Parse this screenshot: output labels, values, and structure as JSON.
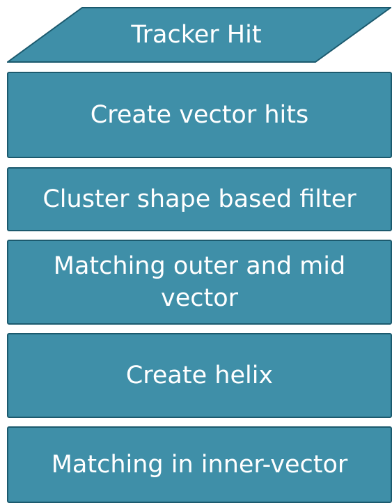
{
  "colors": {
    "box_fill": "#3f8fa8",
    "box_border": "#1c5a6e",
    "text": "#ffffff"
  },
  "input": {
    "label": "Tracker Hit"
  },
  "steps": [
    {
      "label": "Create vector hits"
    },
    {
      "label": "Cluster shape based filter"
    },
    {
      "label": "Matching outer and mid vector"
    },
    {
      "label": "Create helix"
    },
    {
      "label": "Matching in inner-vector"
    }
  ]
}
